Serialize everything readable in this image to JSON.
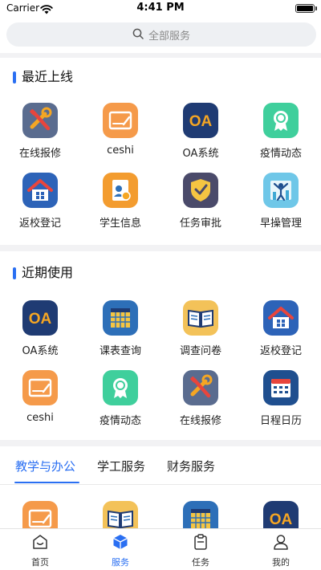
{
  "status_bar": {
    "carrier": "Carrier",
    "time": "4:41 PM",
    "battery_level": 1.0
  },
  "search": {
    "placeholder": "全部服务",
    "icon": "search-icon"
  },
  "recent_online": {
    "title": "最近上线",
    "items": [
      {
        "label": "在线报修",
        "icon": "repair-tools-icon",
        "color": "#5a6c8f"
      },
      {
        "label": "ceshi",
        "icon": "signature-board-icon",
        "color": "#f59a4a"
      },
      {
        "label": "OA系统",
        "icon": "oa-icon",
        "color": "#1f3b73"
      },
      {
        "label": "疫情动态",
        "icon": "medal-icon",
        "color": "#3fcf9c"
      },
      {
        "label": "返校登记",
        "icon": "house-icon",
        "color": "#2d63b8"
      },
      {
        "label": "学生信息",
        "icon": "student-card-icon",
        "color": "#f39c2f"
      },
      {
        "label": "任务审批",
        "icon": "shield-check-icon",
        "color": "#4a4a6a"
      },
      {
        "label": "早操管理",
        "icon": "exercise-icon",
        "color": "#6fc7e8"
      }
    ]
  },
  "recent_used": {
    "title": "近期使用",
    "items": [
      {
        "label": "OA系统",
        "icon": "oa-icon",
        "color": "#1f3b73"
      },
      {
        "label": "课表查询",
        "icon": "timetable-icon",
        "color": "#2d6fb8"
      },
      {
        "label": "调查问卷",
        "icon": "book-icon",
        "color": "#f3c259"
      },
      {
        "label": "返校登记",
        "icon": "house-icon",
        "color": "#2d63b8"
      },
      {
        "label": "ceshi",
        "icon": "signature-board-icon",
        "color": "#f59a4a"
      },
      {
        "label": "疫情动态",
        "icon": "medal-icon",
        "color": "#3fcf9c"
      },
      {
        "label": "在线报修",
        "icon": "repair-tools-icon",
        "color": "#5a6c8f"
      },
      {
        "label": "日程日历",
        "icon": "calendar-icon",
        "color": "#1f4f8f"
      }
    ]
  },
  "tabs": [
    {
      "label": "教学与办公",
      "active": true
    },
    {
      "label": "学工服务",
      "active": false
    },
    {
      "label": "财务服务",
      "active": false
    }
  ],
  "peek_items": [
    {
      "icon": "signature-board-icon",
      "color": "#f59a4a"
    },
    {
      "icon": "book-icon",
      "color": "#f3c259"
    },
    {
      "icon": "timetable-icon",
      "color": "#2d6fb8"
    },
    {
      "icon": "oa-icon",
      "color": "#1f3b73"
    }
  ],
  "bottom_nav": [
    {
      "label": "首页",
      "icon": "home-smile-icon",
      "active": false
    },
    {
      "label": "服务",
      "icon": "cube-icon",
      "active": true
    },
    {
      "label": "任务",
      "icon": "clipboard-icon",
      "active": false
    },
    {
      "label": "我的",
      "icon": "user-icon",
      "active": false
    }
  ],
  "colors": {
    "accent": "#2a6ff2",
    "section_band": "#f2f2f4",
    "search_bg": "#eef0f3"
  }
}
